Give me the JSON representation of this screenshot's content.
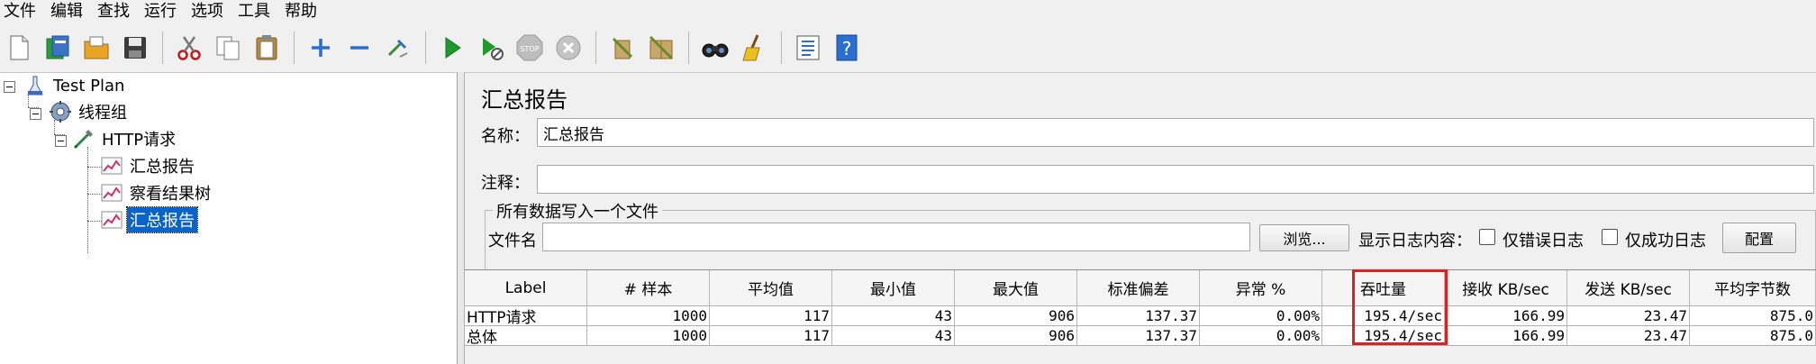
{
  "menu": [
    "文件",
    "编辑",
    "查找",
    "运行",
    "选项",
    "工具",
    "帮助"
  ],
  "toolbar": {
    "icons": [
      "new-icon",
      "templates-icon",
      "open-icon",
      "save-icon",
      "cut-icon",
      "copy-icon",
      "paste-icon",
      "expand-icon",
      "collapse-icon",
      "toggle-icon",
      "start-icon",
      "start-no-pause-icon",
      "stop-icon",
      "shutdown-icon",
      "clear-icon",
      "clear-all-icon",
      "search-icon",
      "reset-search-icon",
      "function-helper-icon",
      "help-icon"
    ]
  },
  "tree": {
    "nodes": [
      {
        "label": "Test Plan",
        "icon": "test-plan-icon"
      },
      {
        "label": "线程组",
        "icon": "thread-group-icon"
      },
      {
        "label": "HTTP请求",
        "icon": "http-request-icon"
      },
      {
        "label": "汇总报告",
        "icon": "listener-icon"
      },
      {
        "label": "察看结果树",
        "icon": "listener-icon"
      },
      {
        "label": "汇总报告",
        "icon": "listener-icon",
        "selected": true
      }
    ]
  },
  "panel": {
    "title": "汇总报告",
    "name_label": "名称：",
    "name_value": "汇总报告",
    "comment_label": "注释：",
    "comment_value": "",
    "file_group_title": "所有数据写入一个文件",
    "filename_label": "文件名",
    "filename_value": "",
    "browse_button": "浏览...",
    "log_content_label": "显示日志内容：",
    "errors_only_label": "仅错误日志",
    "success_only_label": "仅成功日志",
    "configure_button": "配置"
  },
  "table": {
    "columns": [
      "Label",
      "# 样本",
      "平均值",
      "最小值",
      "最大值",
      "标准偏差",
      "异常 %",
      "吞吐量",
      "接收 KB/sec",
      "发送 KB/sec",
      "平均字节数"
    ],
    "rows": [
      [
        "HTTP请求",
        "1000",
        "117",
        "43",
        "906",
        "137.37",
        "0.00%",
        "195.4/sec",
        "166.99",
        "23.47",
        "875.0"
      ],
      [
        "总体",
        "1000",
        "117",
        "43",
        "906",
        "137.37",
        "0.00%",
        "195.4/sec",
        "166.99",
        "23.47",
        "875.0"
      ]
    ],
    "highlighted_column": "吞吐量",
    "highlight_color": "#e02020"
  },
  "colors": {
    "selection": "#0a64c8",
    "background": "#f0f0f0"
  }
}
